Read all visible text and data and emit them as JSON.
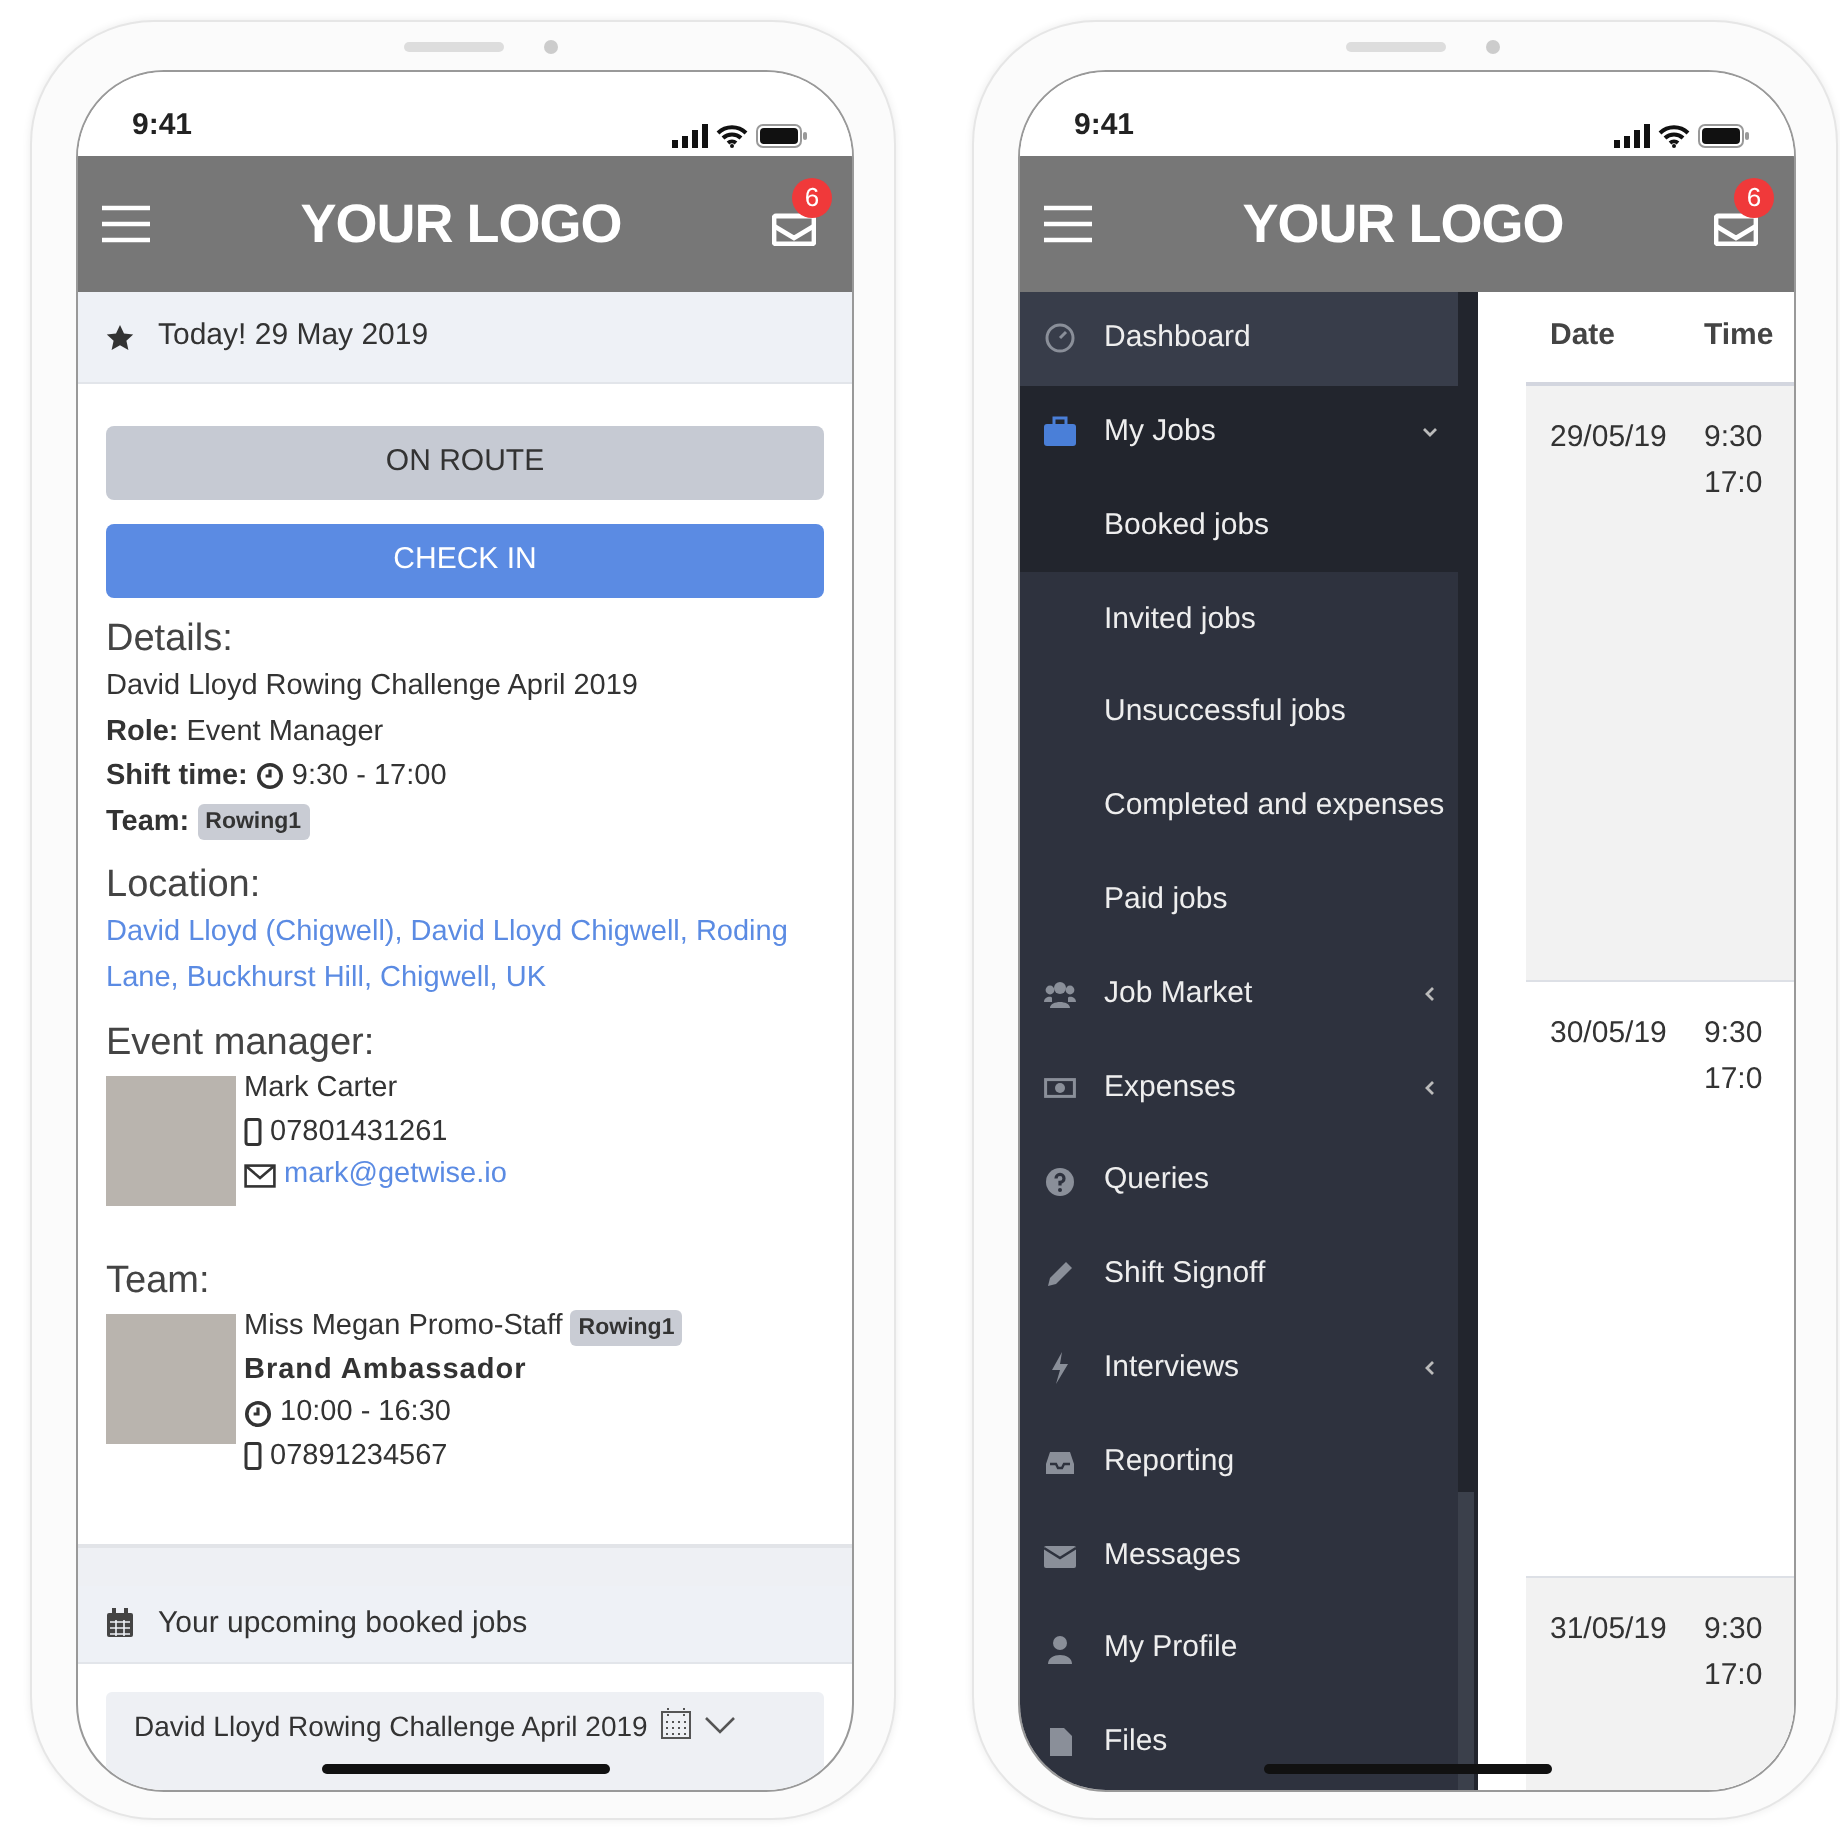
{
  "left_phone": {
    "status_time": "9:41",
    "header": {
      "logo": "YOUR LOGO",
      "badge": "6"
    },
    "today": "Today! 29 May 2019",
    "buttons": [
      {
        "label": "ON ROUTE",
        "kind": "secondary"
      },
      {
        "label": "CHECK IN",
        "kind": "primary"
      }
    ],
    "details": {
      "heading": "Details:",
      "event": "David Lloyd Rowing Challenge April 2019",
      "role_label": "Role:",
      "role": "Event Manager",
      "shift_label": "Shift time:",
      "shift": "9:30 - 17:00",
      "team_label": "Team:",
      "team_badge": "Rowing1"
    },
    "location": {
      "heading": "Location:",
      "address": "David Lloyd (Chigwell), David Lloyd Chigwell, Roding Lane, Buckhurst Hill, Chigwell, UK"
    },
    "event_manager": {
      "heading": "Event manager:",
      "name": "Mark Carter",
      "phone": "07801431261",
      "email": "mark@getwise.io"
    },
    "team": {
      "heading": "Team:",
      "members": [
        {
          "name": "Miss Megan Promo-Staff",
          "badge": "Rowing1",
          "role": "Brand Ambassador",
          "time": "10:00 - 16:30",
          "phone": "07891234567"
        }
      ]
    },
    "upcoming": "Your upcoming booked jobs",
    "job_card": "David Lloyd Rowing Challenge April 2019"
  },
  "right_phone": {
    "status_time": "9:41",
    "header": {
      "logo": "YOUR LOGO",
      "badge": "6"
    },
    "menu": [
      {
        "label": "Dashboard",
        "kind": "dashboard",
        "highlighted": true
      },
      {
        "label": "My Jobs",
        "kind": "briefcase",
        "highlighted": false,
        "expanded": true,
        "children": [
          {
            "label": "Booked jobs",
            "selected": true
          },
          {
            "label": "Invited jobs",
            "selected": false
          },
          {
            "label": "Unsuccessful jobs",
            "selected": false
          },
          {
            "label": "Completed and expenses",
            "selected": false
          },
          {
            "label": "Paid jobs",
            "selected": false
          }
        ]
      },
      {
        "label": "Job Market",
        "kind": "users",
        "highlighted": false,
        "expanded": false
      },
      {
        "label": "Expenses",
        "kind": "money",
        "highlighted": false,
        "expanded": false
      },
      {
        "label": "Queries",
        "kind": "question",
        "highlighted": false
      },
      {
        "label": "Shift Signoff",
        "kind": "pencil",
        "highlighted": false
      },
      {
        "label": "Interviews",
        "kind": "bolt",
        "highlighted": false,
        "expanded": false
      },
      {
        "label": "Reporting",
        "kind": "inbox",
        "highlighted": false
      },
      {
        "label": "Messages",
        "kind": "envelope",
        "highlighted": false
      },
      {
        "label": "My Profile",
        "kind": "user",
        "highlighted": false
      },
      {
        "label": "Files",
        "kind": "file",
        "highlighted": false
      }
    ],
    "table": {
      "columns": [
        "Date",
        "Time"
      ],
      "rows": [
        {
          "date": "29/05/19",
          "time_lines": [
            "9:30",
            "17:0"
          ]
        },
        {
          "date": "30/05/19",
          "time_lines": [
            "9:30",
            "17:0"
          ]
        },
        {
          "date": "31/05/19",
          "time_lines": [
            "9:30",
            "17:0"
          ]
        }
      ]
    }
  }
}
